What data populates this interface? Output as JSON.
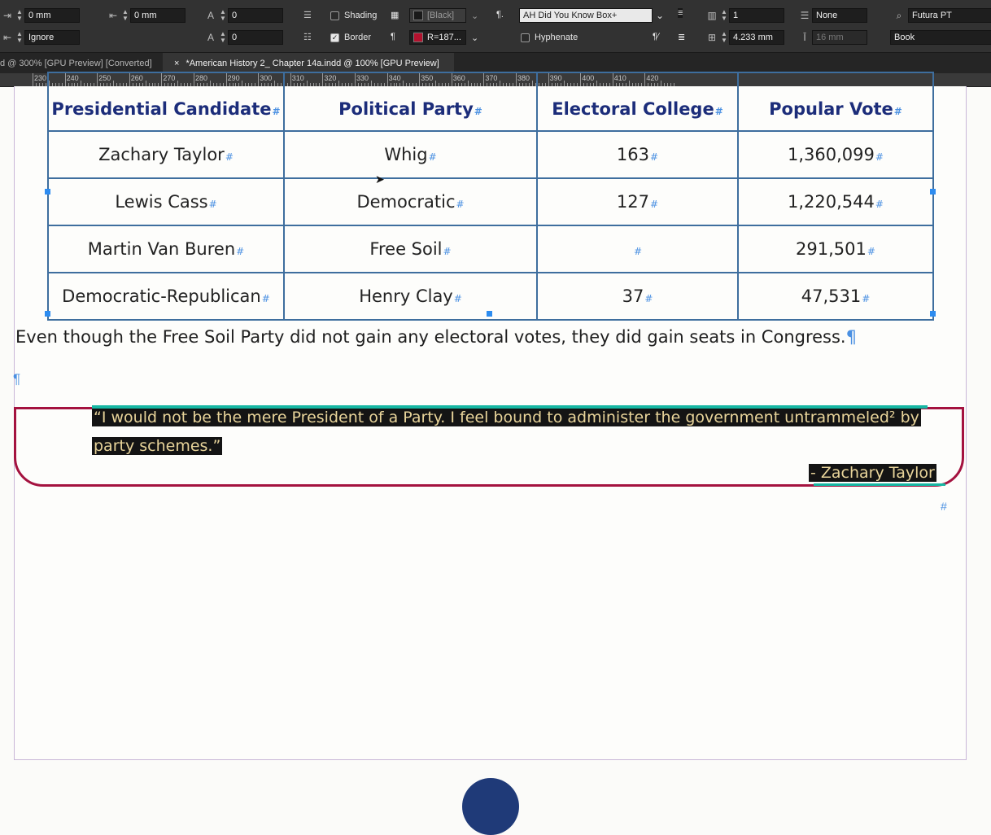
{
  "toolbar": {
    "row1": {
      "space_before": "0 mm",
      "space_after": "0 mm",
      "drop_cap_lines": "0",
      "shading_label": "Shading",
      "shading_color": "[Black]",
      "paragraph_style": "AH Did You Know Box+",
      "columns": "1",
      "span": "None",
      "font_family": "Futura PT"
    },
    "row2": {
      "align_to_grid": "Ignore",
      "drop_cap_chars": "0",
      "border_label": "Border",
      "border_color": "R=187...",
      "hyphenate_label": "Hyphenate",
      "gutter": "4.233 mm",
      "indent_right_last": "16 mm",
      "font_style": "Book"
    },
    "colors": {
      "shading_swatch": "#1a1a1a",
      "border_swatch": "#b3122e"
    }
  },
  "tabs": [
    {
      "label": "d @ 300% [GPU Preview] [Converted]",
      "active": false
    },
    {
      "label": "*American History 2_ Chapter 14a.indd @ 100% [GPU Preview]",
      "active": true,
      "close": "×"
    }
  ],
  "ruler": {
    "labels": [
      "230",
      "240",
      "250",
      "260",
      "270",
      "280",
      "290",
      "300",
      "310",
      "320",
      "330",
      "340",
      "350",
      "360",
      "370",
      "380",
      "390",
      "400",
      "410",
      "420"
    ]
  },
  "table": {
    "headers": [
      "Presidential Candidate",
      "Political Party",
      "Electoral College",
      "Popular Vote"
    ],
    "rows": [
      [
        "Zachary Taylor",
        "Whig",
        "163",
        "1,360,099"
      ],
      [
        "Lewis Cass",
        "Democratic",
        "127",
        "1,220,544"
      ],
      [
        "Martin Van Buren",
        "Free Soil",
        "",
        "291,501"
      ],
      [
        "Democratic-Republican",
        "Henry Clay",
        "37",
        "47,531"
      ]
    ],
    "cell_mark": "#"
  },
  "body": {
    "paragraph": "Even though the Free Soil Party did not gain any electoral votes, they did gain seats in Congress.",
    "pilcrow": "¶"
  },
  "quote": {
    "line1": "“I would not be the mere President of a Party. I feel bound to administer the government untrammeled² by",
    "line2": "party schemes.”",
    "attribution": "- Zachary Taylor",
    "frame_color": "#a4123f",
    "highlight_color": "#16b7a3"
  }
}
